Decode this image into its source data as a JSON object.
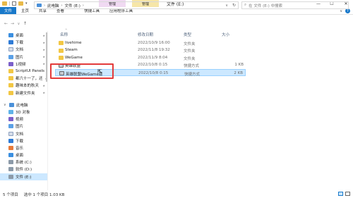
{
  "window": {
    "title": "文件 (E:)",
    "context_tabs": [
      "管理",
      "管理"
    ],
    "controls": {
      "minimize": "—",
      "maximize": "☐",
      "close": "✕"
    }
  },
  "ribbon": {
    "tabs": [
      "文件",
      "主页",
      "共享",
      "查看",
      "快捷工具",
      "应用程序工具"
    ],
    "expand_glyph": "∨"
  },
  "address": {
    "path": [
      "此电脑",
      "文件 (E:)"
    ],
    "search_placeholder": "在 文件 (E:) 中搜索"
  },
  "sidebar": {
    "quick_access": [
      {
        "label": "桌面",
        "icon": "ico-desktop"
      },
      {
        "label": "下载",
        "icon": "ico-download"
      },
      {
        "label": "文档",
        "icon": "ico-doc"
      },
      {
        "label": "图片",
        "icon": "ico-pic"
      },
      {
        "label": "1视频",
        "icon": "ico-video"
      },
      {
        "label": "ScriptUI Panels",
        "icon": "ico-folder"
      },
      {
        "label": "都六十一了，还",
        "icon": "ico-folder"
      },
      {
        "label": "趣味本的秋天",
        "icon": "ico-folder"
      },
      {
        "label": "新建文件夹",
        "icon": "ico-folder"
      }
    ],
    "this_pc_label": "此电脑",
    "this_pc": [
      {
        "label": "3D 对象",
        "icon": "ico-3d"
      },
      {
        "label": "视频",
        "icon": "ico-video"
      },
      {
        "label": "图片",
        "icon": "ico-pic"
      },
      {
        "label": "文档",
        "icon": "ico-doc"
      },
      {
        "label": "下载",
        "icon": "ico-download"
      },
      {
        "label": "音乐",
        "icon": "ico-music"
      },
      {
        "label": "桌面",
        "icon": "ico-desktop"
      },
      {
        "label": "系统 (C:)",
        "icon": "ico-drive"
      },
      {
        "label": "软件 (D:)",
        "icon": "ico-drive"
      },
      {
        "label": "文件 (E:)",
        "icon": "ico-drive",
        "selected": true
      }
    ]
  },
  "columns": {
    "name": "名称",
    "date": "修改日期",
    "type": "类型",
    "size": "大小"
  },
  "files": [
    {
      "name": "livehime",
      "date": "2022/10/9 16:00",
      "type": "文件夹",
      "size": "",
      "kind": "folder"
    },
    {
      "name": "Steam",
      "date": "2022/11/8 19:32",
      "type": "文件夹",
      "size": "",
      "kind": "folder"
    },
    {
      "name": "WeGame",
      "date": "2022/11/9 8:04",
      "type": "文件夹",
      "size": "",
      "kind": "folder"
    },
    {
      "name": "英雄联盟",
      "date": "2022/10/8 0:15",
      "type": "快捷方式",
      "size": "1 KB",
      "kind": "shortcut"
    },
    {
      "name": "英雄联盟WeGame版",
      "date": "2022/10/8 0:15",
      "type": "快捷方式",
      "size": "2 KB",
      "kind": "shortcut",
      "selected": true
    }
  ],
  "status": {
    "count": "5 个项目",
    "selection": "选中 1 个项目  1.03 KB"
  }
}
